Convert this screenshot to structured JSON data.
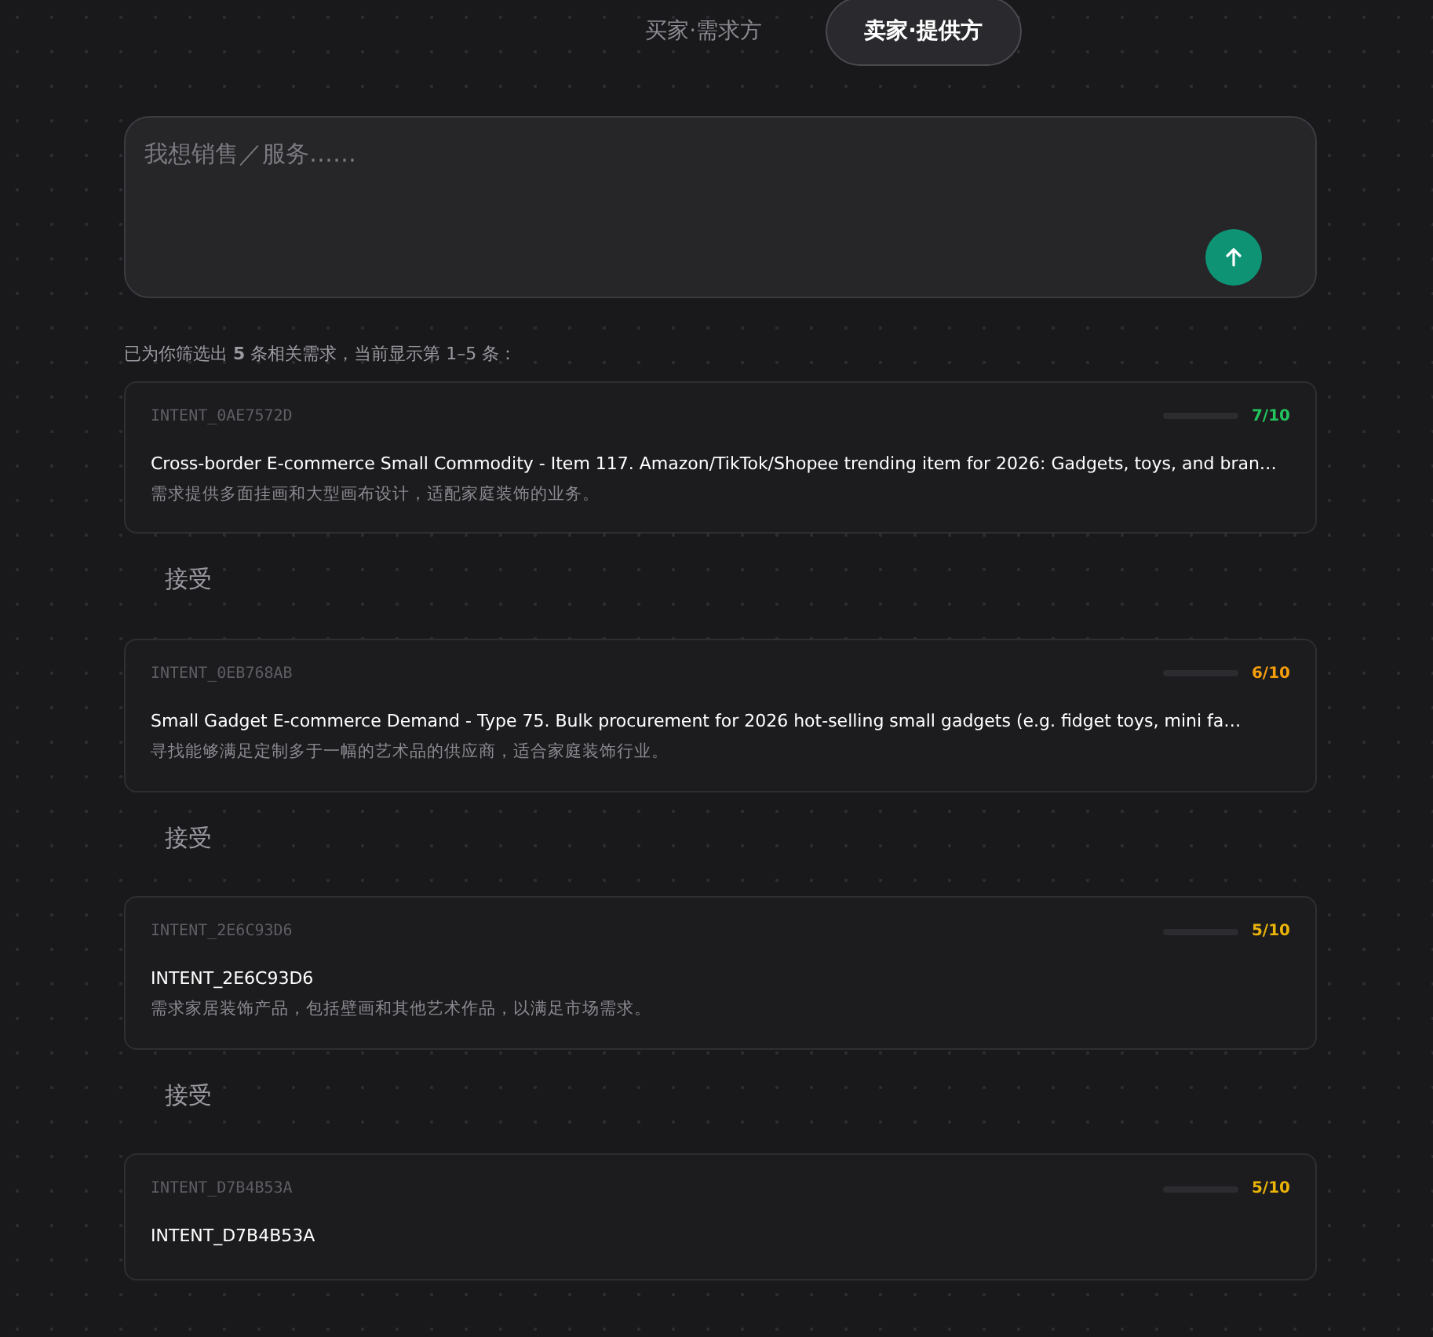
{
  "tabs": [
    {
      "label": "买家·需求方",
      "selected": false
    },
    {
      "label": "卖家·提供方",
      "selected": true
    }
  ],
  "composer": {
    "placeholder": "我想销售／服务……"
  },
  "summary": "已为你筛选出 **5** 条相关需求，当前显示第 1–5 条：",
  "results": [
    {
      "id": "INTENT_0AE7572D",
      "score": "7/10",
      "color": "#22c55e",
      "title": "Cross-border E-commerce Small Commodity - Item 117. Amazon/TikTok/Shopee trending item for 2026: Gadgets, toys, and bran…",
      "description": "需求提供多面挂画和大型画布设计，适配家庭装饰的业务。",
      "action": "接受"
    },
    {
      "id": "INTENT_0EB768AB",
      "score": "6/10",
      "color": "#f59e0b",
      "title": "Small Gadget E-commerce Demand - Type 75. Bulk procurement for 2026 hot-selling small gadgets (e.g. fidget toys, mini fa…",
      "description": "寻找能够满足定制多于一幅的艺术品的供应商，适合家庭装饰行业。",
      "action": "接受"
    },
    {
      "id": "INTENT_2E6C93D6",
      "score": "5/10",
      "color": "#eab308",
      "title": "INTENT_2E6C93D6",
      "description": "需求家居装饰产品，包括壁画和其他艺术作品，以满足市场需求。",
      "action": "接受"
    },
    {
      "id": "INTENT_D7B4B53A",
      "score": "5/10",
      "color": "#eab308",
      "title": "INTENT_D7B4B53A"
    }
  ]
}
